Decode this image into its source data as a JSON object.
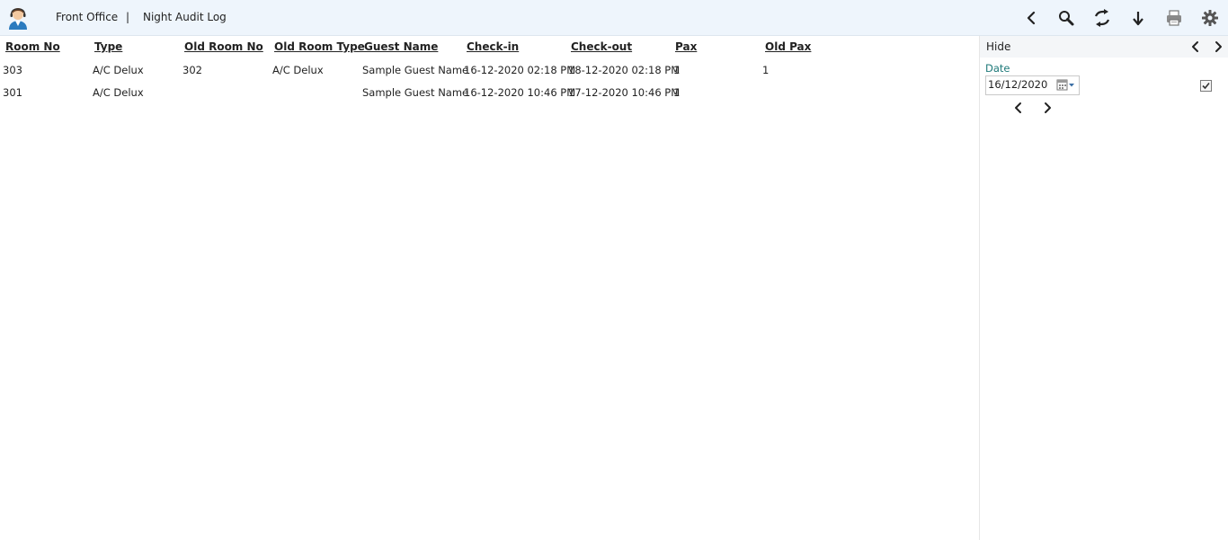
{
  "header": {
    "breadcrumb_module": "Front Office",
    "breadcrumb_separator": "|",
    "breadcrumb_page": "Night Audit Log",
    "toolbar_icons": [
      "back-icon",
      "search-icon",
      "refresh-icon",
      "download-icon",
      "print-icon",
      "settings-icon"
    ]
  },
  "table": {
    "columns": [
      "Room No",
      "Type",
      "Old Room No",
      "Old Room Type",
      "Guest Name",
      "Check-in",
      "Check-out",
      "Pax",
      "Old Pax"
    ],
    "rows": [
      [
        "303",
        "A/C Delux",
        "302",
        "A/C Delux",
        "Sample Guest Name",
        "16-12-2020 02:18 PM",
        "18-12-2020 02:18 PM",
        "1",
        "1"
      ],
      [
        "301",
        "A/C Delux",
        "",
        "",
        "Sample Guest Name",
        "16-12-2020 10:46 PM",
        "17-12-2020 10:46 PM",
        "1",
        ""
      ]
    ]
  },
  "filter_panel": {
    "hide_label": "Hide",
    "date_label": "Date",
    "date_value": "16/12/2020",
    "checkbox_checked": true
  },
  "colors": {
    "topbar_bg": "#eef5fc",
    "date_label": "#1f7a7a"
  }
}
